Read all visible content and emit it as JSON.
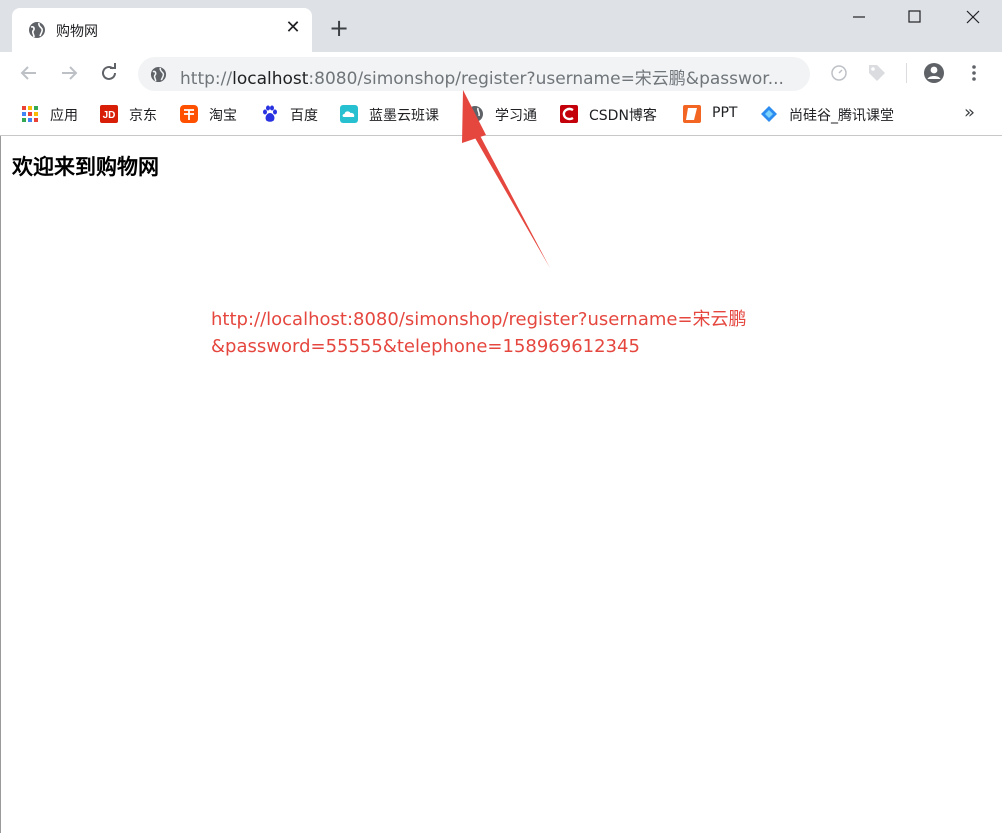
{
  "browser": {
    "tab": {
      "title": "购物网",
      "icon": "globe-icon"
    },
    "address": {
      "scheme": "http://",
      "host": "localhost",
      "rest": ":8080/simonshop/register?username=宋云鹏&passwor..."
    }
  },
  "bookmarks": [
    {
      "label": "应用",
      "icon": "apps-grid-icon"
    },
    {
      "label": "京东",
      "icon": "jd-icon"
    },
    {
      "label": "淘宝",
      "icon": "taobao-icon"
    },
    {
      "label": "百度",
      "icon": "baidu-icon"
    },
    {
      "label": "蓝墨云班课",
      "icon": "lanmo-cloud-icon"
    },
    {
      "label": "学习通",
      "icon": "xuexitong-icon"
    },
    {
      "label": "CSDN博客",
      "icon": "csdn-icon"
    },
    {
      "label": "PPT",
      "icon": "ppt-icon"
    },
    {
      "label": "尚硅谷_腾讯课堂",
      "icon": "tencent-classroom-icon"
    }
  ],
  "bookmarks_more": "»",
  "page": {
    "heading": "欢迎来到购物网",
    "annotation_line1": "http://localhost:8080/simonshop/register?username=宋云鹏",
    "annotation_line2": "&password=55555&telephone=158969612345"
  },
  "colors": {
    "annotation": "#e5473f",
    "titlebar": "#dee1e6",
    "omnibox": "#f1f3f4"
  }
}
